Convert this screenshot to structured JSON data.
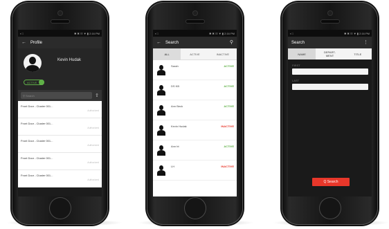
{
  "colors": {
    "active": "#5fb047",
    "inactive": "#e8372a",
    "accent": "#e8372a"
  },
  "status": {
    "left": "▪ □",
    "right": "✱ ✖ ☷ ▼ ▮ 2:16 PM"
  },
  "profile": {
    "title": "Profile",
    "back_icon": "back-arrow-icon",
    "name": "Kevin Hudak",
    "badge": "ACTIVE",
    "search_placeholder": "Search",
    "items": [
      {
        "label": "Front Door - Cluster 001...",
        "detail": "Authorized"
      },
      {
        "label": "Front Door - Cluster 001...",
        "detail": "Authorized"
      },
      {
        "label": "Front Door - Cluster 001...",
        "detail": "Authorized"
      },
      {
        "label": "Front Door - Cluster 001...",
        "detail": "Authorized"
      },
      {
        "label": "Front Door - Cluster 001...",
        "detail": "Authorized"
      }
    ]
  },
  "search": {
    "title": "Search",
    "tabs": [
      "ALL",
      "ACTIVE",
      "INACTIVE"
    ],
    "users": [
      {
        "name": "Sarah",
        "status": "ACTIVE"
      },
      {
        "name": "DS KB",
        "status": "ACTIVE"
      },
      {
        "name": "Ann Beck",
        "status": "ACTIVE"
      },
      {
        "name": "Kevin Hudak",
        "status": "INACTIVE"
      },
      {
        "name": "Ann bt",
        "status": "ACTIVE"
      },
      {
        "name": "LH",
        "status": "INACTIVE"
      }
    ]
  },
  "form": {
    "title": "Search",
    "tabs": [
      "NAME",
      "DEPART-\nMENT",
      "TITLE"
    ],
    "first_label": "FIRST",
    "last_label": "LAST",
    "button": "Q  Search"
  }
}
